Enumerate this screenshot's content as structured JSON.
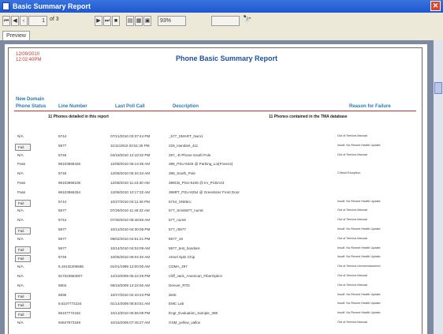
{
  "window": {
    "title": "Basic Summary Report"
  },
  "toolbar": {
    "page_current": "1",
    "page_of": "of 3",
    "zoom": "93%"
  },
  "tabs": [
    "Preview"
  ],
  "report": {
    "date": "12/09/2010",
    "time": "12:02:40PM",
    "title": "Phone Basic Summary Report",
    "domain": "New Domain",
    "columns": [
      "Phone Status",
      "Line Number",
      "Last Poll Call",
      "Description",
      "Reason for Failure"
    ],
    "summary_left": "11  Phones detailed in this report",
    "summary_right": "11  Phones contained in the TMA database",
    "rows": [
      {
        "status": "N/A",
        "line": "5744",
        "poll": "07/21/2010 03:37:44 PM",
        "desc": "_577_SMART_Num1",
        "reason": "Out of Service-Manual",
        "button": false
      },
      {
        "status": "Fail",
        "line": "5977",
        "poll": "11/11/2010 03:51:25 PM",
        "desc": "226_Handset_411",
        "reason": "Insuff. No Recent Health Update",
        "button": true
      },
      {
        "status": "N/A",
        "line": "5746",
        "poll": "03/18/2010 12:10:32 PM",
        "desc": "297_-E-Phone South Pole",
        "reason": "Out of Service-Manual",
        "button": false
      },
      {
        "status": "Pass",
        "line": "96103968426",
        "poll": "12/08/2010 06:14:36 AM",
        "desc": "396_PSU-6426 @ Parking_Lot(Francis)",
        "reason": "",
        "button": false
      },
      {
        "status": "N/A",
        "line": "5746",
        "poll": "12/08/2010 05:34:34 AM",
        "desc": "398_South_Pole",
        "reason": "Critical Exception",
        "button": false
      },
      {
        "status": "Pass",
        "line": "96103966106",
        "poll": "12/08/2010 11:23:30 AM",
        "desc": "398CB_PSU-6106 @ Irv_PCBA23",
        "reason": "",
        "button": false
      },
      {
        "status": "Pass",
        "line": "96103966254",
        "poll": "12/08/2010 10:17:32 AM",
        "desc": "398RT_PSU-6254 @ Greenbrier Front Door",
        "reason": "",
        "button": false
      },
      {
        "status": "Fail",
        "line": "5744",
        "poll": "10/27/2010 04:11:46 PM",
        "desc": "5744_SN65cc",
        "reason": "Insuff. No Recent Health Update",
        "button": true
      },
      {
        "status": "N/A",
        "line": "5977",
        "poll": "07/29/2010 11:49:22 AM",
        "desc": "577_Sms5977_num6",
        "reason": "Out of Service-Manual",
        "button": false
      },
      {
        "status": "N/A",
        "line": "5744",
        "poll": "07/30/2010 08:48:56 AM",
        "desc": "577_num9",
        "reason": "Out of Service-Manual",
        "button": false
      },
      {
        "status": "Fail",
        "line": "5977",
        "poll": "10/12/2010 04:30:06 PM",
        "desc": "577_r5977",
        "reason": "Insuff. No Recent Health Update",
        "button": true
      },
      {
        "status": "N/A",
        "line": "5977",
        "poll": "09/02/2010 04:51:21 PM",
        "desc": "5977_19",
        "reason": "Out of Service-Manual",
        "button": false
      },
      {
        "status": "Fail",
        "line": "5977",
        "poll": "10/14/2010 04:04:09 AM",
        "desc": "5977_test_handset",
        "reason": "Insuff. No Recent Health Update",
        "button": true
      },
      {
        "status": "Fail",
        "line": "5749",
        "poll": "10/05/2010 09:04:40 AM",
        "desc": "Atmel Spkr Chip",
        "reason": "Insuff. No Recent Health Update",
        "button": true
      },
      {
        "status": "N/A",
        "line": "9,19132206685",
        "poll": "01/01/1999 12:00:00 AM",
        "desc": "CDMA_297",
        "reason": "Out of Service-Uncommissioned",
        "button": false
      },
      {
        "status": "N/A",
        "line": "917323583007",
        "poll": "12/10/2009 05:22:29 PM",
        "desc": "Cliff_Jack_American_FiberOptics",
        "reason": "Out of Service-Manual",
        "button": false
      },
      {
        "status": "N/A",
        "line": "5904",
        "poll": "09/19/2009 12:22:50 AM",
        "desc": "Denver_RTD",
        "reason": "Out of Service-Manual",
        "button": false
      },
      {
        "status": "Fail",
        "line": "5936",
        "poll": "10/27/2010 02:43:23 PM",
        "desc": "desk",
        "reason": "Insuff. No Recent Health Update",
        "button": true
      },
      {
        "status": "Fail",
        "line": "9,6107772234",
        "poll": "01/14/2009 08:53:51 AM",
        "desc": "EMC Lab",
        "reason": "Insuff. No Recent Health Update",
        "button": true
      },
      {
        "status": "Fail",
        "line": "96107772182",
        "poll": "10/13/2010 06:55:09 PM",
        "desc": "Engr_Evaluation_Sample_398",
        "reason": "Insuff. No Recent Health Update",
        "button": true
      },
      {
        "status": "N/A",
        "line": "94847973349",
        "poll": "10/15/2008 07:45:27 AM",
        "desc": "GSM_yellow_vallov",
        "reason": "Out of Service-Manual",
        "button": false
      }
    ]
  }
}
